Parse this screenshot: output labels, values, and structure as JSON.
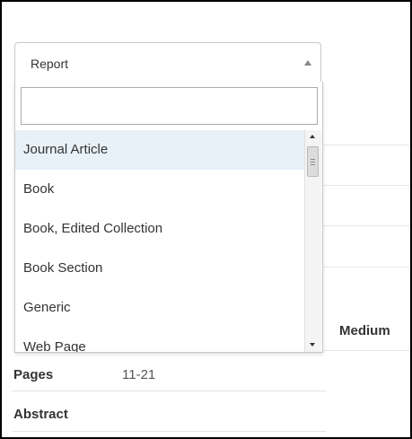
{
  "select": {
    "value": "Report"
  },
  "search": {
    "value": "",
    "placeholder": ""
  },
  "options": [
    {
      "label": "Journal Article",
      "highlighted": true
    },
    {
      "label": "Book",
      "highlighted": false
    },
    {
      "label": "Book, Edited Collection",
      "highlighted": false
    },
    {
      "label": "Book Section",
      "highlighted": false
    },
    {
      "label": "Generic",
      "highlighted": false
    },
    {
      "label": "Web Page",
      "highlighted": false
    }
  ],
  "form": {
    "medium_label": "Medium",
    "pages_label": "Pages",
    "pages_value": "11-21",
    "abstract_label": "Abstract"
  },
  "colors": {
    "highlight": "#e8f1f8",
    "border": "#c8c8c8",
    "text": "#333333"
  }
}
